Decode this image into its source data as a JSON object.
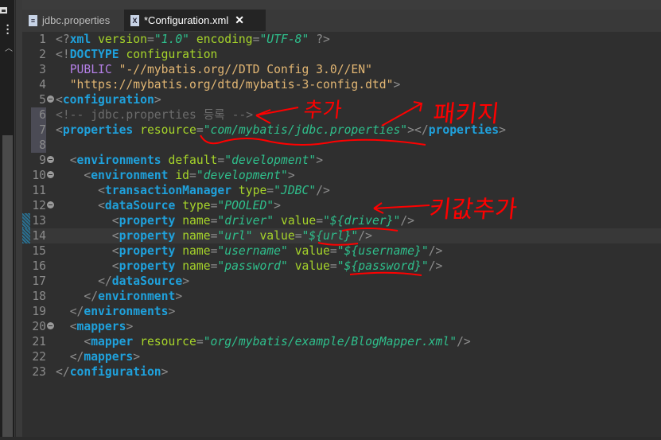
{
  "tabs": [
    {
      "label": "jdbc.properties",
      "icon": "properties-file-icon",
      "active": false
    },
    {
      "label": "*Configuration.xml",
      "icon": "xml-file-icon",
      "active": true,
      "close_icon": "close-icon"
    }
  ],
  "lines": [
    {
      "n": "1",
      "tokens": [
        [
          "b",
          "<?"
        ],
        [
          "t",
          "xml"
        ],
        [
          "p",
          " "
        ],
        [
          "a",
          "version"
        ],
        [
          "b",
          "="
        ],
        [
          "s",
          "\"1.0\""
        ],
        [
          "p",
          " "
        ],
        [
          "a",
          "encoding"
        ],
        [
          "b",
          "="
        ],
        [
          "s",
          "\"UTF-8\""
        ],
        [
          "p",
          " "
        ],
        [
          "b",
          "?>"
        ]
      ]
    },
    {
      "n": "2",
      "tokens": [
        [
          "b",
          "<!"
        ],
        [
          "t",
          "DOCTYPE"
        ],
        [
          "p",
          " "
        ],
        [
          "a",
          "configuration"
        ]
      ]
    },
    {
      "n": "3",
      "tokens": [
        [
          "p",
          "  "
        ],
        [
          "k",
          "PUBLIC"
        ],
        [
          "p",
          " "
        ],
        [
          "d",
          "\"-//mybatis.org//DTD Config 3.0//EN\""
        ]
      ]
    },
    {
      "n": "4",
      "tokens": [
        [
          "p",
          "  "
        ],
        [
          "d",
          "\"https://mybatis.org/dtd/mybatis-3-config.dtd\""
        ],
        [
          "b",
          ">"
        ]
      ]
    },
    {
      "n": "5",
      "fold": true,
      "tokens": [
        [
          "b",
          "<"
        ],
        [
          "t",
          "configuration"
        ],
        [
          "b",
          ">"
        ]
      ]
    },
    {
      "n": "6",
      "hl": true,
      "tokens": [
        [
          "c",
          "<!-- jdbc.properties 등록 -->"
        ]
      ]
    },
    {
      "n": "7",
      "hl": true,
      "tokens": [
        [
          "b",
          "<"
        ],
        [
          "t",
          "properties"
        ],
        [
          "p",
          " "
        ],
        [
          "a",
          "resource"
        ],
        [
          "b",
          "="
        ],
        [
          "s",
          "\"com/mybatis/jdbc.properties\""
        ],
        [
          "b",
          "></"
        ],
        [
          "t",
          "properties"
        ],
        [
          "b",
          ">"
        ]
      ]
    },
    {
      "n": "8",
      "hl": true,
      "tokens": []
    },
    {
      "n": "9",
      "fold": true,
      "tokens": [
        [
          "p",
          "  "
        ],
        [
          "b",
          "<"
        ],
        [
          "t",
          "environments"
        ],
        [
          "p",
          " "
        ],
        [
          "a",
          "default"
        ],
        [
          "b",
          "="
        ],
        [
          "s",
          "\"development\""
        ],
        [
          "b",
          ">"
        ]
      ]
    },
    {
      "n": "10",
      "fold": true,
      "tokens": [
        [
          "p",
          "    "
        ],
        [
          "b",
          "<"
        ],
        [
          "t",
          "environment"
        ],
        [
          "p",
          " "
        ],
        [
          "a",
          "id"
        ],
        [
          "b",
          "="
        ],
        [
          "s",
          "\"development\""
        ],
        [
          "b",
          ">"
        ]
      ]
    },
    {
      "n": "11",
      "tokens": [
        [
          "p",
          "      "
        ],
        [
          "b",
          "<"
        ],
        [
          "t",
          "transactionManager"
        ],
        [
          "p",
          " "
        ],
        [
          "a",
          "type"
        ],
        [
          "b",
          "="
        ],
        [
          "s",
          "\"JDBC\""
        ],
        [
          "b",
          "/>"
        ]
      ]
    },
    {
      "n": "12",
      "fold": true,
      "tokens": [
        [
          "p",
          "      "
        ],
        [
          "b",
          "<"
        ],
        [
          "t",
          "dataSource"
        ],
        [
          "p",
          " "
        ],
        [
          "a",
          "type"
        ],
        [
          "b",
          "="
        ],
        [
          "s",
          "\"POOLED\""
        ],
        [
          "b",
          ">"
        ]
      ]
    },
    {
      "n": "13",
      "mark": true,
      "tokens": [
        [
          "p",
          "        "
        ],
        [
          "b",
          "<"
        ],
        [
          "t",
          "property"
        ],
        [
          "p",
          " "
        ],
        [
          "a",
          "name"
        ],
        [
          "b",
          "="
        ],
        [
          "s",
          "\"driver\""
        ],
        [
          "p",
          " "
        ],
        [
          "a",
          "value"
        ],
        [
          "b",
          "="
        ],
        [
          "s",
          "\"${driver}\""
        ],
        [
          "b",
          "/>"
        ]
      ]
    },
    {
      "n": "14",
      "mark": true,
      "cur": true,
      "tokens": [
        [
          "p",
          "        "
        ],
        [
          "b",
          "<"
        ],
        [
          "t",
          "property"
        ],
        [
          "p",
          " "
        ],
        [
          "a",
          "name"
        ],
        [
          "b",
          "="
        ],
        [
          "s",
          "\"url\""
        ],
        [
          "p",
          " "
        ],
        [
          "a",
          "value"
        ],
        [
          "b",
          "="
        ],
        [
          "s",
          "\"${url}\""
        ],
        [
          "b",
          "/>"
        ]
      ]
    },
    {
      "n": "15",
      "tokens": [
        [
          "p",
          "        "
        ],
        [
          "b",
          "<"
        ],
        [
          "t",
          "property"
        ],
        [
          "p",
          " "
        ],
        [
          "a",
          "name"
        ],
        [
          "b",
          "="
        ],
        [
          "s",
          "\"username\""
        ],
        [
          "p",
          " "
        ],
        [
          "a",
          "value"
        ],
        [
          "b",
          "="
        ],
        [
          "s",
          "\"${username}\""
        ],
        [
          "b",
          "/>"
        ]
      ]
    },
    {
      "n": "16",
      "tokens": [
        [
          "p",
          "        "
        ],
        [
          "b",
          "<"
        ],
        [
          "t",
          "property"
        ],
        [
          "p",
          " "
        ],
        [
          "a",
          "name"
        ],
        [
          "b",
          "="
        ],
        [
          "s",
          "\"password\""
        ],
        [
          "p",
          " "
        ],
        [
          "a",
          "value"
        ],
        [
          "b",
          "="
        ],
        [
          "s",
          "\"${password}\""
        ],
        [
          "b",
          "/>"
        ]
      ]
    },
    {
      "n": "17",
      "tokens": [
        [
          "p",
          "      "
        ],
        [
          "b",
          "</"
        ],
        [
          "t",
          "dataSource"
        ],
        [
          "b",
          ">"
        ]
      ]
    },
    {
      "n": "18",
      "tokens": [
        [
          "p",
          "    "
        ],
        [
          "b",
          "</"
        ],
        [
          "t",
          "environment"
        ],
        [
          "b",
          ">"
        ]
      ]
    },
    {
      "n": "19",
      "tokens": [
        [
          "p",
          "  "
        ],
        [
          "b",
          "</"
        ],
        [
          "t",
          "environments"
        ],
        [
          "b",
          ">"
        ]
      ]
    },
    {
      "n": "20",
      "fold": true,
      "tokens": [
        [
          "p",
          "  "
        ],
        [
          "b",
          "<"
        ],
        [
          "t",
          "mappers"
        ],
        [
          "b",
          ">"
        ]
      ]
    },
    {
      "n": "21",
      "tokens": [
        [
          "p",
          "    "
        ],
        [
          "b",
          "<"
        ],
        [
          "t",
          "mapper"
        ],
        [
          "p",
          " "
        ],
        [
          "a",
          "resource"
        ],
        [
          "b",
          "="
        ],
        [
          "s",
          "\"org/mybatis/example/BlogMapper.xml\""
        ],
        [
          "b",
          "/>"
        ]
      ]
    },
    {
      "n": "22",
      "tokens": [
        [
          "p",
          "  "
        ],
        [
          "b",
          "</"
        ],
        [
          "t",
          "mappers"
        ],
        [
          "b",
          ">"
        ]
      ]
    },
    {
      "n": "23",
      "tokens": [
        [
          "b",
          "</"
        ],
        [
          "t",
          "configuration"
        ],
        [
          "b",
          ">"
        ]
      ]
    }
  ],
  "annotations": {
    "add": "추가",
    "package": "패키지",
    "key_add": "키값추가",
    "color": "#ff0000"
  }
}
